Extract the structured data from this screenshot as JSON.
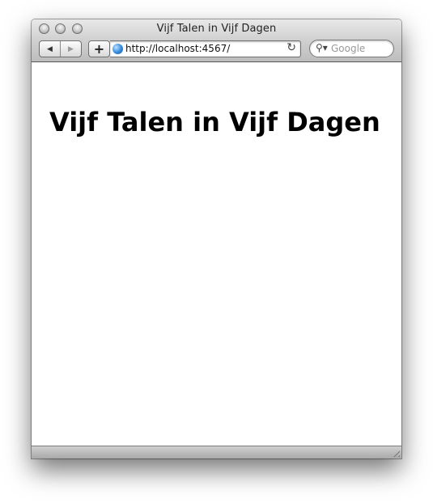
{
  "window": {
    "title": "Vijf Talen in Vijf Dagen"
  },
  "toolbar": {
    "back_glyph": "◀",
    "forward_glyph": "▶",
    "add_glyph": "+",
    "url": "http://localhost:4567/",
    "reload_glyph": "↻",
    "search_placeholder": "Google",
    "search_glyph": "⚲▾"
  },
  "page": {
    "heading": "Vijf Talen in Vijf Dagen"
  },
  "icons": [
    "close-icon",
    "minimize-icon",
    "zoom-icon",
    "back-icon",
    "forward-icon",
    "add-bookmark-icon",
    "globe-icon",
    "reload-icon",
    "search-icon",
    "resize-grip-icon"
  ]
}
